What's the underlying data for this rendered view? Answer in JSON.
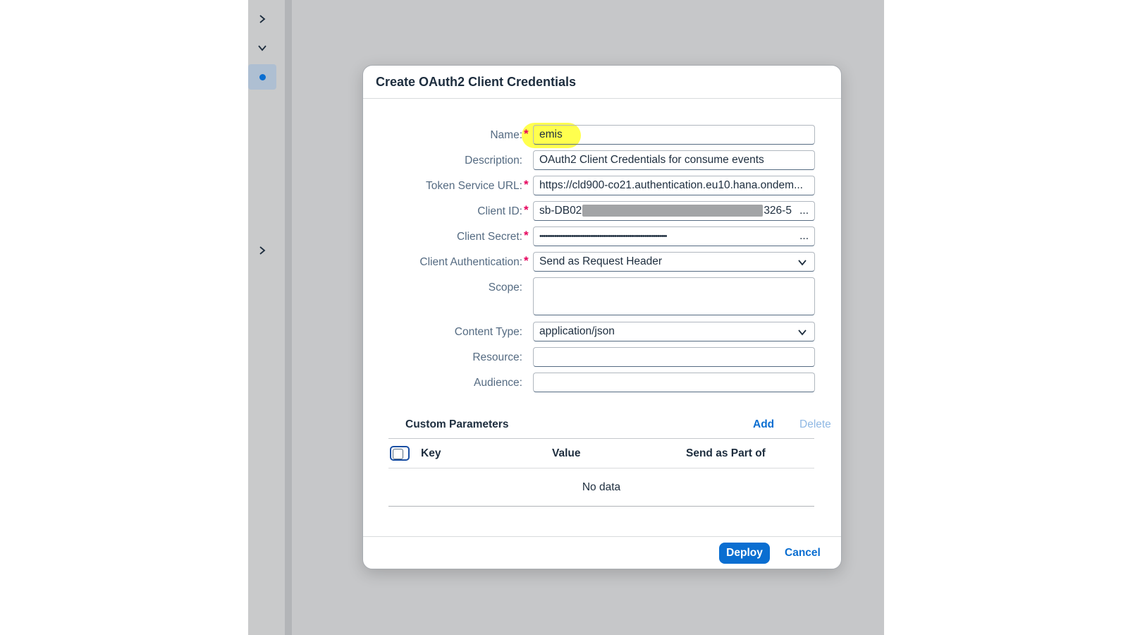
{
  "dialog": {
    "title": "Create OAuth2 Client Credentials",
    "fields": {
      "name": {
        "label": "Name:",
        "value": "emis"
      },
      "description": {
        "label": "Description:",
        "value": "OAuth2 Client Credentials for consume events"
      },
      "token_url": {
        "label": "Token Service URL:",
        "value": "https://cld900-co21.authentication.eu10.hana.ondem..."
      },
      "client_id": {
        "label": "Client ID:",
        "value_prefix": "sb-DB02",
        "value_suffix": "326-5",
        "more": "..."
      },
      "client_secret": {
        "label": "Client Secret:",
        "value": "••••••••••••••••••••••••••••••••••••••••••••••••••••••••••••••••••••",
        "more": "..."
      },
      "client_auth": {
        "label": "Client Authentication:",
        "value": "Send as Request Header"
      },
      "scope": {
        "label": "Scope:",
        "value": ""
      },
      "content_type": {
        "label": "Content Type:",
        "value": "application/json"
      },
      "resource": {
        "label": "Resource:",
        "value": ""
      },
      "audience": {
        "label": "Audience:",
        "value": ""
      }
    },
    "required_marker": "*",
    "custom_parameters": {
      "title": "Custom Parameters",
      "add_label": "Add",
      "delete_label": "Delete",
      "columns": [
        "Key",
        "Value",
        "Send as Part of"
      ],
      "empty_text": "No data"
    },
    "footer": {
      "deploy_label": "Deploy",
      "cancel_label": "Cancel"
    }
  },
  "colors": {
    "accent": "#0a6ed1",
    "required": "#e6005c",
    "highlight": "#ffff3b"
  }
}
